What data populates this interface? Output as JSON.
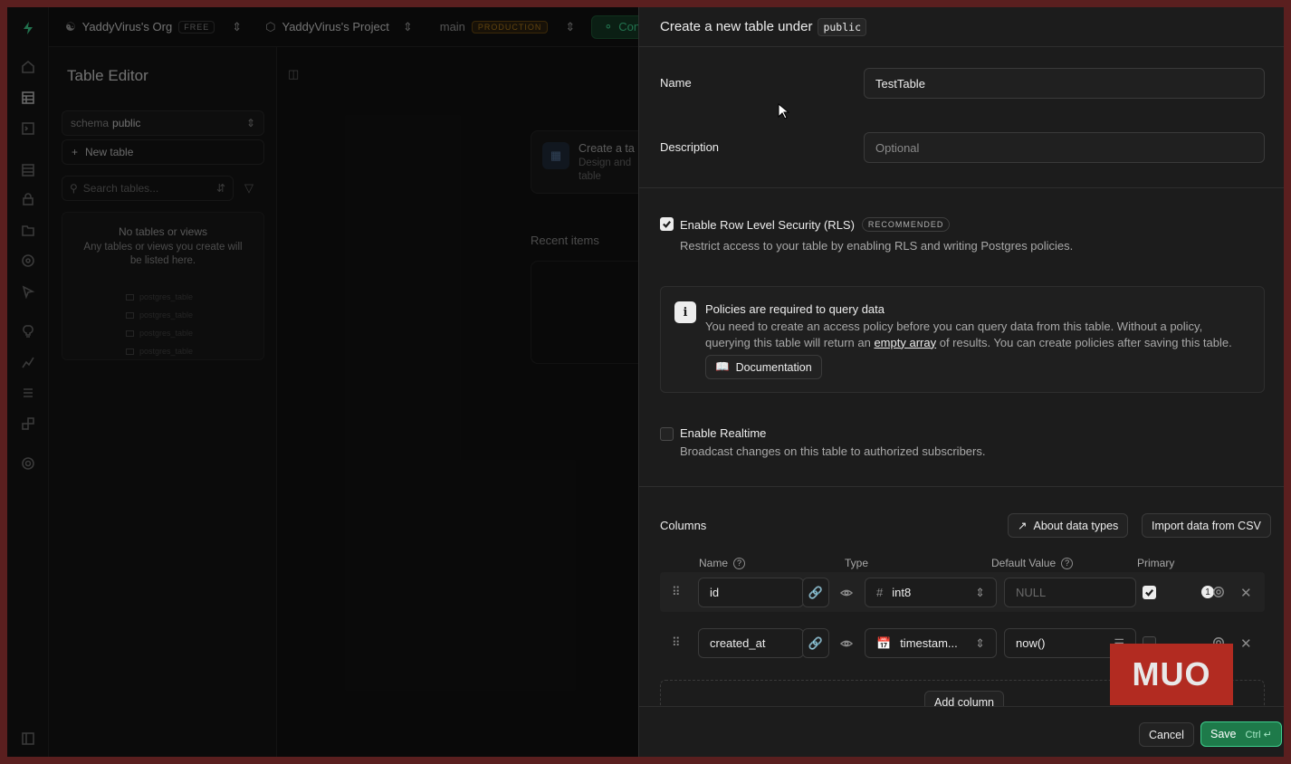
{
  "topbar": {
    "org": "YaddyVirus's Org",
    "org_badge": "FREE",
    "project": "YaddyVirus's Project",
    "branch": "main",
    "branch_badge": "PRODUCTION",
    "connect": "Conne"
  },
  "sidebar": {
    "title": "Table Editor",
    "schema_label": "schema",
    "schema_value": "public",
    "new_table": "New table",
    "search_placeholder": "Search tables...",
    "empty_title": "No tables or views",
    "empty_desc": "Any tables or views you create will be listed here.",
    "ghost_item": "postgres_table"
  },
  "main": {
    "card_title": "Create a ta",
    "card_desc_1": "Design and",
    "card_desc_2": "table",
    "recent": "Recent items"
  },
  "panel": {
    "title": "Create a new table under",
    "schema": "public",
    "name_label": "Name",
    "name_value": "TestTable",
    "description_label": "Description",
    "description_placeholder": "Optional",
    "rls_label": "Enable Row Level Security (RLS)",
    "rls_badge": "RECOMMENDED",
    "rls_desc": "Restrict access to your table by enabling RLS and writing Postgres policies.",
    "rls_checked": true,
    "alert_title": "Policies are required to query data",
    "alert_desc_1": "You need to create an access policy before you can query data from this table. Without a policy, querying this table will return an",
    "alert_link": "empty array",
    "alert_desc_2": "of results. You can create policies after saving this table.",
    "doc_button": "Documentation",
    "realtime_label": "Enable Realtime",
    "realtime_desc": "Broadcast changes on this table to authorized subscribers.",
    "realtime_checked": false,
    "columns_label": "Columns",
    "about_types": "About data types",
    "import_csv": "Import data from CSV",
    "col_headers": {
      "name": "Name",
      "type": "Type",
      "default": "Default Value",
      "primary": "Primary"
    },
    "rows": [
      {
        "name": "id",
        "type": "int8",
        "type_icon": "hash-icon",
        "default": "NULL",
        "primary": true,
        "badge": "1"
      },
      {
        "name": "created_at",
        "type": "timestam...",
        "type_icon": "calendar-icon",
        "default": "now()",
        "primary": false
      }
    ],
    "add_column": "Add column",
    "cancel": "Cancel",
    "save": "Save",
    "save_shortcut": "Ctrl ↵"
  },
  "watermark": "MUO",
  "colors": {
    "accent": "#3ecf8e",
    "save_bg": "#1e7a4a",
    "watermark": "#b22b21"
  }
}
